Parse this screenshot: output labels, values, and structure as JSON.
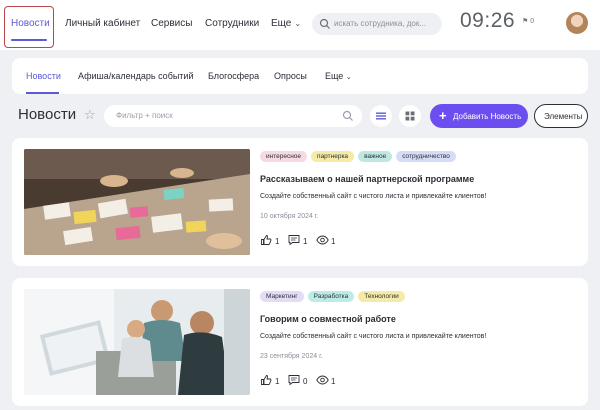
{
  "topnav": {
    "active": "Новости",
    "items": [
      "Личный кабинет",
      "Сервисы",
      "Сотрудники"
    ],
    "more": "Еще"
  },
  "search": {
    "placeholder": "искать сотрудника, док..."
  },
  "clock": "09:26",
  "flag": "⚑ 0",
  "subnav": {
    "items": [
      "Новости",
      "Афиша/календарь событий",
      "Блогосфера",
      "Опросы",
      "Еще"
    ]
  },
  "toolbar": {
    "title": "Новости",
    "filter_placeholder": "Фильтр + поиск",
    "add_label": "Добавить Новость",
    "elements_label": "Элементы"
  },
  "colors": {
    "accent": "#5b5bd6",
    "add_button": "#6c4ef0",
    "highlight_border": "#b8474f"
  },
  "news": [
    {
      "tags": [
        {
          "label": "интересное",
          "color": "#f6d9e2"
        },
        {
          "label": "партнерка",
          "color": "#f6eaa7"
        },
        {
          "label": "важное",
          "color": "#bde9e2"
        },
        {
          "label": "сотрудничество",
          "color": "#d7dcf6"
        }
      ],
      "title": "Рассказываем о нашей партнерской программе",
      "description": "Создайте собственный сайт с чистого листа и привлекайте клиентов!",
      "date": "10 октября 2024 г.",
      "likes": "1",
      "comments": "1",
      "views": "1"
    },
    {
      "tags": [
        {
          "label": "Маркетинг",
          "color": "#e4dcf6"
        },
        {
          "label": "Разработка",
          "color": "#bdece6"
        },
        {
          "label": "Технологии",
          "color": "#f6eaa7"
        }
      ],
      "title": "Говорим о совместной работе",
      "description": "Создайте собственный сайт с чистого листа и привлекайте клиентов!",
      "date": "23 сентября 2024 г.",
      "likes": "1",
      "comments": "0",
      "views": "1"
    }
  ]
}
